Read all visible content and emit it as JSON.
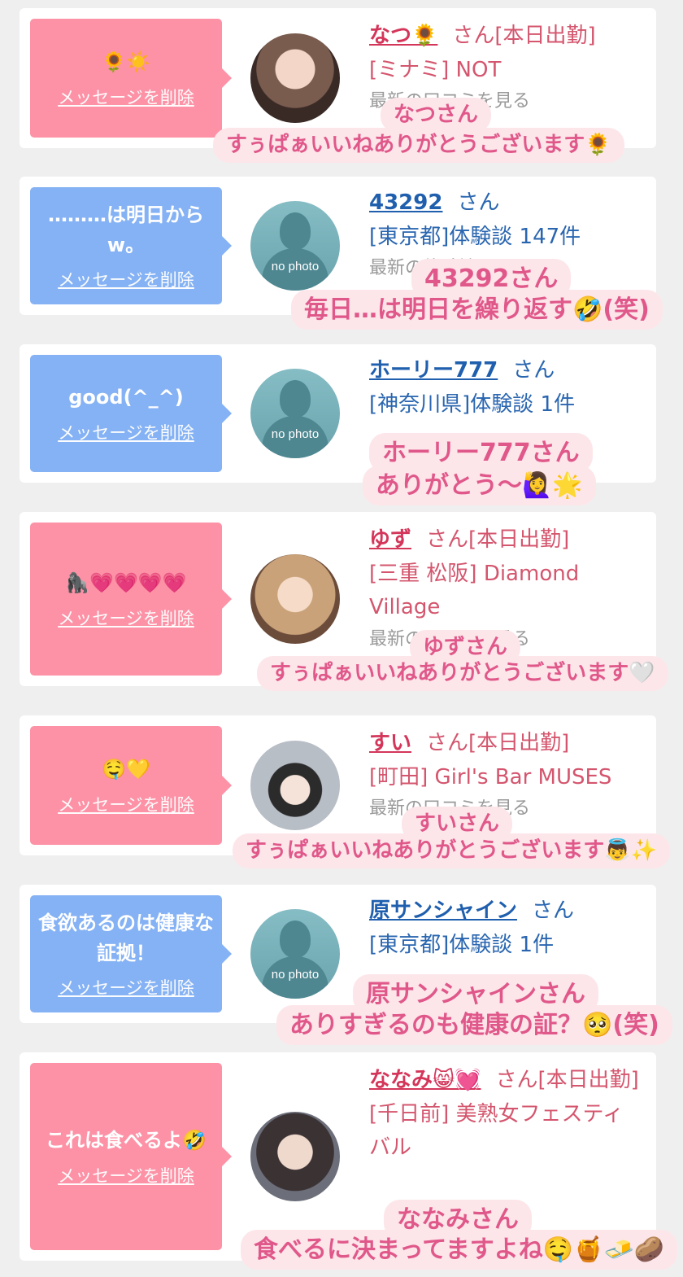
{
  "delete_label": "メッセージを削除",
  "no_photo": "no photo",
  "items": [
    {
      "message": "🌻☀️",
      "name": "なつ🌻",
      "suffix": "さん[本日出勤]",
      "detail": "[ミナミ] NOT",
      "footer": "最新の口コミを見る",
      "caption_name": "なつさん",
      "caption_text": "すぅぱぁいいねありがとうございます🌻"
    },
    {
      "message": "………は明日からw。",
      "name": "43292",
      "suffix": "さん",
      "detail": "[東京都]体験談 147件",
      "footer": "最新の体験談",
      "caption_name": "43292さん",
      "caption_text": "毎日…は明日を繰り返す🤣(笑)"
    },
    {
      "message": "good(^_^)",
      "name": "ホーリー777",
      "suffix": "さん",
      "detail": "[神奈川県]体験談 1件",
      "caption_name": "ホーリー777さん",
      "caption_text": "ありがとう〜🙋‍♀️🌟"
    },
    {
      "message": "🦍💗💗💗💗",
      "name": "ゆず",
      "suffix": "さん[本日出勤]",
      "detail": "[三重 松阪] Diamond Village",
      "footer": "最新の口コミを見る",
      "caption_name": "ゆずさん",
      "caption_text": "すぅぱぁいいねありがとうございます🤍"
    },
    {
      "message": "🤤💛",
      "name": "すい",
      "suffix": "さん[本日出勤]",
      "detail": "[町田] Girl's Bar MUSES",
      "footer": "最新の口コミを見る",
      "caption_name": "すいさん",
      "caption_text": "すぅぱぁいいねありがとうございます👼✨"
    },
    {
      "message": "食欲あるのは健康な証拠！",
      "name": "原サンシャイン",
      "suffix": "さん",
      "detail": "[東京都]体験談 1件",
      "caption_name": "原サンシャインさん",
      "caption_text": "ありすぎるのも健康の証？🥺(笑)"
    },
    {
      "message": "これは食べるよ🤣",
      "name": "ななみ😸💓",
      "suffix": "さん[本日出勤]",
      "detail": "[千日前] 美熟女フェスティバル",
      "caption_name": "ななみさん",
      "caption_text": "食べるに決まってますよね🤤🍯🧈🥔"
    }
  ]
}
